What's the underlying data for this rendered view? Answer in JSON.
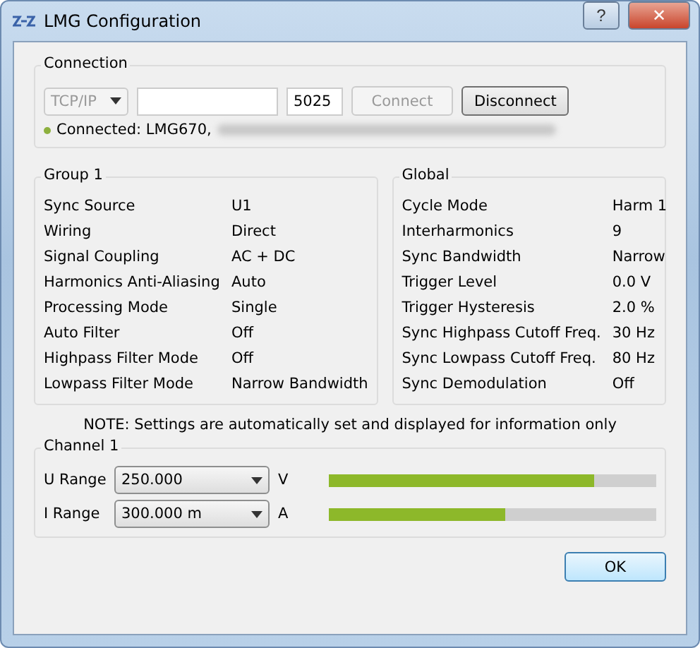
{
  "window": {
    "title": "LMG Configuration",
    "help_button": "?",
    "close_button": "✕"
  },
  "connection": {
    "title": "Connection",
    "protocol": {
      "value": "TCP/IP",
      "disabled": true
    },
    "port": "5025",
    "buttons": [
      {
        "label": "Connect",
        "disabled": true
      },
      {
        "label": "Disconnect",
        "disabled": false
      }
    ],
    "status": {
      "text": "Connected: LMG670,",
      "color": "#8db03e"
    }
  },
  "group": {
    "title": "Group 1",
    "rows": [
      {
        "label": "Sync Source",
        "value": "U1"
      },
      {
        "label": "Wiring",
        "value": "Direct"
      },
      {
        "label": "Signal Coupling",
        "value": "AC + DC"
      },
      {
        "label": "Harmonics Anti-Aliasing",
        "value": "Auto"
      },
      {
        "label": "Processing Mode",
        "value": "Single"
      },
      {
        "label": "Auto Filter",
        "value": "Off"
      },
      {
        "label": "Highpass Filter Mode",
        "value": "Off"
      },
      {
        "label": "Lowpass Filter Mode",
        "value": "Narrow Bandwidth"
      }
    ]
  },
  "global": {
    "title": "Global",
    "rows": [
      {
        "label": "Cycle Mode",
        "value": "Harm 1"
      },
      {
        "label": "Interharmonics",
        "value": "9"
      },
      {
        "label": "Sync Bandwidth",
        "value": "Narrow"
      },
      {
        "label": "Trigger Level",
        "value": "0.0 V"
      },
      {
        "label": "Trigger Hysteresis",
        "value": "2.0 %"
      },
      {
        "label": "Sync Highpass Cutoff Freq.",
        "value": "30 Hz"
      },
      {
        "label": "Sync Lowpass Cutoff Freq.",
        "value": "80 Hz"
      },
      {
        "label": "Sync Demodulation",
        "value": "Off"
      }
    ]
  },
  "note": "NOTE: Settings are automatically set and displayed for information only",
  "channel": {
    "title": "Channel 1",
    "ranges": [
      {
        "label": "U Range",
        "value": "250.000",
        "unit": "V",
        "level": 0.81
      },
      {
        "label": "I Range",
        "value": "300.000 m",
        "unit": "A",
        "level": 0.54
      }
    ]
  },
  "buttons": [
    "OK"
  ]
}
